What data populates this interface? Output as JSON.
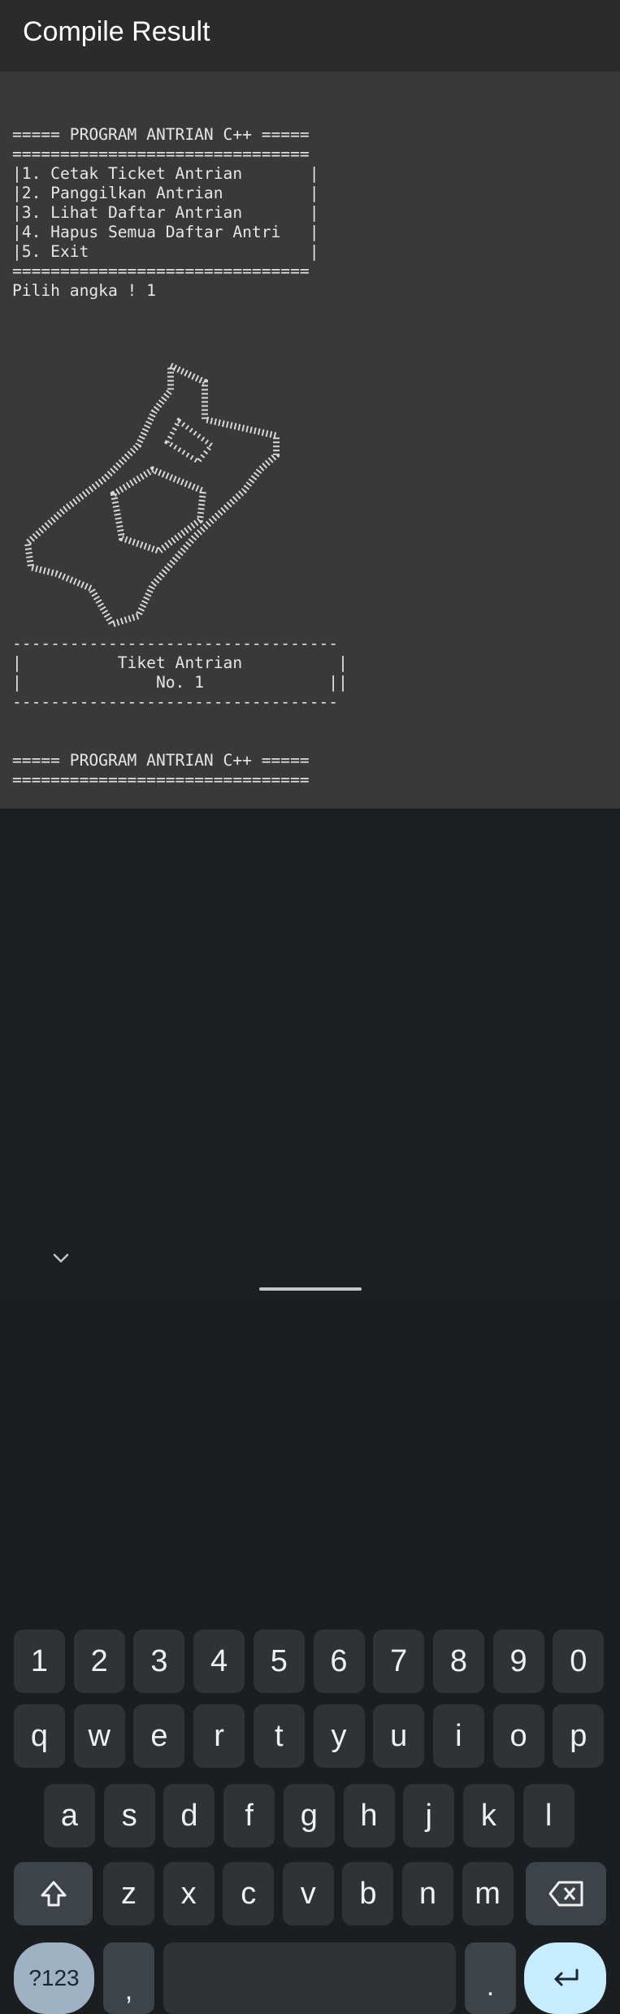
{
  "appbar": {
    "title": "Compile Result"
  },
  "console": {
    "output_1": "===== PROGRAM ANTRIAN C++ =====\n===============================\n|1. Cetak Ticket Antrian       |\n|2. Panggilkan Antrian         |\n|3. Lihat Daftar Antrian       |\n|4. Hapus Semua Daftar Antri   |\n|5. Exit                       |\n===============================\nPilih angka ! 1",
    "output_2": "----------------------------------\n|          Tiket Antrian          |\n|              No. 1             ||\n----------------------------------",
    "output_3": "===== PROGRAM ANTRIAN C++ =====\n==============================="
  },
  "keyboard": {
    "row1": [
      "1",
      "2",
      "3",
      "4",
      "5",
      "6",
      "7",
      "8",
      "9",
      "0"
    ],
    "row2": [
      "q",
      "w",
      "e",
      "r",
      "t",
      "y",
      "u",
      "i",
      "o",
      "p"
    ],
    "row3": [
      "a",
      "s",
      "d",
      "f",
      "g",
      "h",
      "j",
      "k",
      "l"
    ],
    "row4": [
      "z",
      "x",
      "c",
      "v",
      "b",
      "n",
      "m"
    ],
    "symbols_label": "?123",
    "comma_label": ",",
    "period_label": ".",
    "shift_icon": "shift-arrow-up-icon",
    "backspace_icon": "backspace-icon",
    "enter_icon": "enter-return-arrow-icon",
    "hide_icon": "chevron-down-icon"
  },
  "colors": {
    "appbar": "#2b2b2b",
    "console_bg": "#393939",
    "console_text": "#e6e6e6",
    "keyboard_bg": "#1b1f22",
    "key": "#2f3336",
    "key_function": "#3e4348",
    "symbols_key": "#9fb2c3",
    "enter_key": "#c7ecfd"
  }
}
